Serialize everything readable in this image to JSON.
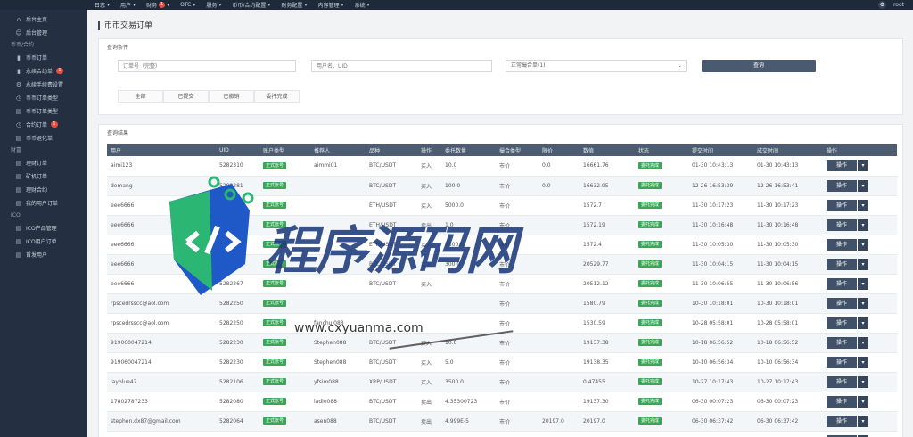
{
  "topbar": {
    "nav": [
      {
        "label": "日志",
        "badge": ""
      },
      {
        "label": "用户",
        "badge": ""
      },
      {
        "label": "财务",
        "badge": "1"
      },
      {
        "label": "OTC",
        "badge": ""
      },
      {
        "label": "服务",
        "badge": ""
      },
      {
        "label": "币币/合约配置",
        "badge": ""
      },
      {
        "label": "财务配置",
        "badge": ""
      },
      {
        "label": "内容管理",
        "badge": ""
      },
      {
        "label": "系统",
        "badge": ""
      }
    ],
    "user": "root"
  },
  "sidebar": {
    "items": [
      {
        "label": "后台主页",
        "icon": "home-icon",
        "count": ""
      },
      {
        "label": "后台管理",
        "icon": "user-icon",
        "count": ""
      },
      {
        "group": "币币/合约"
      },
      {
        "label": "币币订单",
        "icon": "bookmark-icon",
        "count": ""
      },
      {
        "label": "永续合约单",
        "icon": "bookmark-icon",
        "count": "1"
      },
      {
        "label": "永续手续费设置",
        "icon": "gear-icon",
        "count": ""
      },
      {
        "label": "币币订单类型",
        "icon": "clock-icon",
        "count": ""
      },
      {
        "label": "币币订单类型",
        "icon": "list-icon",
        "count": ""
      },
      {
        "label": "合约订单",
        "icon": "clock-icon",
        "count": "1"
      },
      {
        "label": "币币退化单",
        "icon": "list-icon",
        "count": ""
      },
      {
        "group": "财富"
      },
      {
        "label": "理财订单",
        "icon": "list-icon",
        "count": ""
      },
      {
        "label": "矿机订单",
        "icon": "list-icon",
        "count": ""
      },
      {
        "label": "理财合约",
        "icon": "list-icon",
        "count": ""
      },
      {
        "label": "我的用户订单",
        "icon": "list-icon",
        "count": ""
      },
      {
        "group": "ICO"
      },
      {
        "label": "ICO产品管理",
        "icon": "list-icon",
        "count": ""
      },
      {
        "label": "ICO用户订单",
        "icon": "list-icon",
        "count": ""
      },
      {
        "label": "首发用户",
        "icon": "list-icon",
        "count": ""
      }
    ]
  },
  "page": {
    "title": "币币交易订单",
    "filter_header": "查询条件",
    "order_placeholder": "订单号（完整）",
    "user_placeholder": "用户名、UID",
    "select_value": "正常撮合单(1)",
    "query_label": "查询",
    "tabs": [
      "全部",
      "已提交",
      "已撤销",
      "委托完成"
    ],
    "results_header": "查询结果"
  },
  "table": {
    "columns": [
      "用户",
      "UID",
      "账户类型",
      "推荐人",
      "品种",
      "操作",
      "委托数量",
      "撮合类型",
      "限价",
      "数值",
      "状态",
      "提交时间",
      "成交时间",
      "操作"
    ],
    "action_label": "操作",
    "rows": [
      [
        "aimi123",
        "5282310",
        "正式账号",
        "aimmi01",
        "BTC/USDT",
        "买入",
        "10.0",
        "市价",
        "0.0",
        "16661.76",
        "委托完成",
        "01-30 10:43:13",
        "01-30 10:43:13"
      ],
      [
        "demang",
        "5282281",
        "正式账号",
        "",
        "BTC/USDT",
        "买入",
        "100.0",
        "市价",
        "0.0",
        "16632.95",
        "委托完成",
        "12-26 16:53:39",
        "12-26 16:53:41"
      ],
      [
        "eee6666",
        "5282267",
        "正式账号",
        "",
        "ETH/USDT",
        "买入",
        "5000.0",
        "市价",
        "",
        "1572.7",
        "委托完成",
        "11-30 10:17:23",
        "11-30 10:17:23"
      ],
      [
        "eee6666",
        "5282267",
        "正式账号",
        "",
        "ETH/USDT",
        "卖出",
        "1.0",
        "市价",
        "",
        "1572.19",
        "委托完成",
        "11-30 10:16:48",
        "11-30 10:16:48"
      ],
      [
        "eee6666",
        "5282267",
        "正式账号",
        "",
        "ETH/USDT",
        "买入",
        "3300.0",
        "市价",
        "",
        "1572.4",
        "委托完成",
        "11-30 10:05:30",
        "11-30 10:05:30"
      ],
      [
        "eee6666",
        "5282267",
        "正式账号",
        "",
        "BTC/USDT",
        "买入",
        "300.0",
        "市价",
        "",
        "20529.77",
        "委托完成",
        "11-30 10:04:15",
        "11-30 10:04:15"
      ],
      [
        "eee6666",
        "5282267",
        "正式账号",
        "",
        "BTC/USDT",
        "买入",
        "",
        "市价",
        "",
        "20512.12",
        "委托完成",
        "11-30 10:06:55",
        "11-30 10:06:56"
      ],
      [
        "rpscedrsscc@aol.com",
        "5282250",
        "正式账号",
        "",
        "",
        "",
        "",
        "市价",
        "",
        "1580.79",
        "委托完成",
        "10-30 10:18:01",
        "10-30 10:18:01"
      ],
      [
        "rpscedrsscc@aol.com",
        "5282250",
        "正式账号",
        "fanchui088",
        "",
        "",
        "",
        "市价",
        "",
        "1530.59",
        "委托完成",
        "10-28 05:58:01",
        "10-28 05:58:01"
      ],
      [
        "919060047214",
        "5282230",
        "正式账号",
        "Stephen088",
        "BTC/USDT",
        "买入",
        "10.0",
        "市价",
        "",
        "19137.38",
        "委托完成",
        "10-18 06:56:52",
        "10-18 06:56:52"
      ],
      [
        "919060047214",
        "5282230",
        "正式账号",
        "Stephen088",
        "BTC/USDT",
        "买入",
        "5.0",
        "市价",
        "",
        "19138.35",
        "委托完成",
        "10-10 06:56:34",
        "10-10 06:56:34"
      ],
      [
        "layblue47",
        "5282106",
        "正式账号",
        "yfsim088",
        "XRP/USDT",
        "买入",
        "3500.0",
        "市价",
        "",
        "0.47455",
        "委托完成",
        "10-27 10:17:43",
        "10-27 10:17:43"
      ],
      [
        "17802787233",
        "5282080",
        "正式账号",
        "ladie088",
        "BTC/USDT",
        "卖出",
        "4.35300723",
        "市价",
        "",
        "19137.30",
        "委托完成",
        "06-30 00:07:23",
        "06-30 00:07:23"
      ],
      [
        "stephen.dx87@gmail.com",
        "5282064",
        "正式账号",
        "asen088",
        "BTC/USDT",
        "卖出",
        "4.999E-5",
        "市价",
        "20197.0",
        "20197.0",
        "委托完成",
        "06-30 06:37:42",
        "06-30 06:37:42"
      ],
      [
        "stephen.dx87@gmail.com",
        "5282064",
        "正式账号",
        "asen088",
        "BTC/USDT",
        "买入",
        "1.0",
        "市价",
        "1.0",
        "",
        "委托完成",
        "06-27 15:50:23",
        "06-27 15:50:23"
      ]
    ]
  },
  "watermark": {
    "title": "程序源码网",
    "url": "www.cxyuanma.com"
  }
}
